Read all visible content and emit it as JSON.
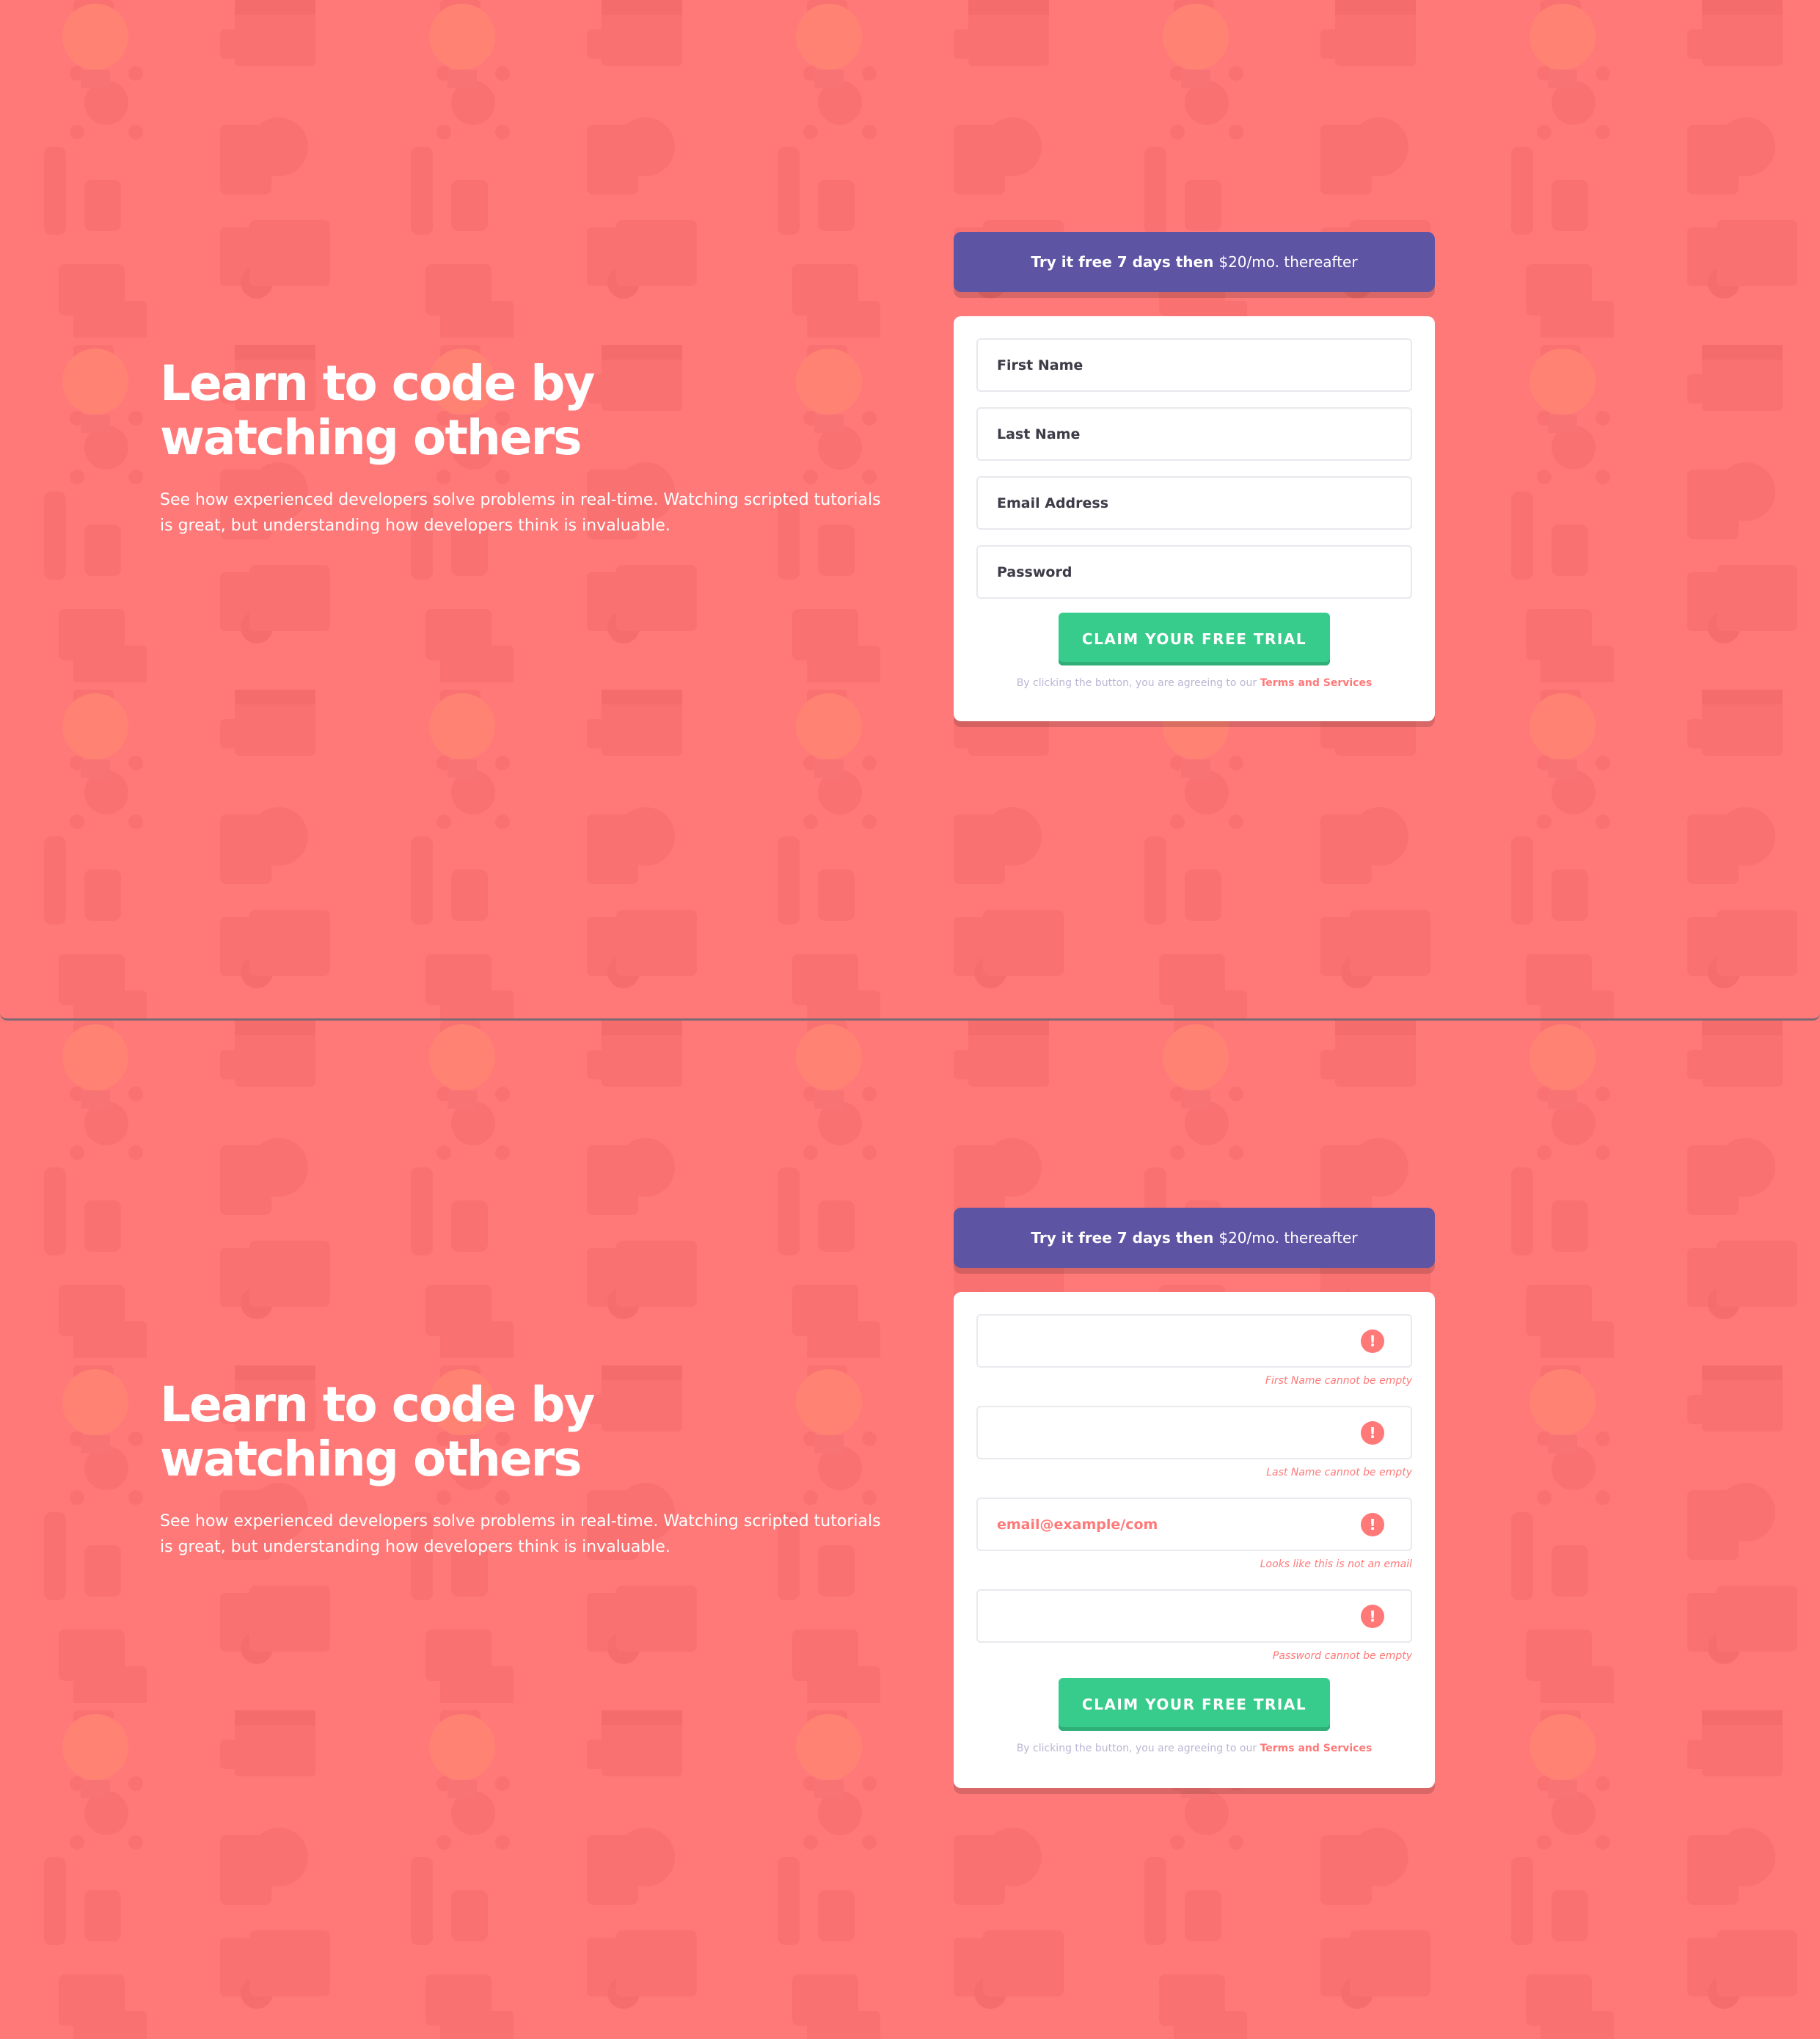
{
  "hero": {
    "title": "Learn to code by watching others",
    "description": "See how experienced developers solve problems in real-time. Watching scripted tutorials is great, but understanding how developers think is invaluable."
  },
  "banner": {
    "bold": "Try it free 7 days then",
    "rest": "$20/mo. thereafter"
  },
  "form": {
    "placeholders": {
      "first_name": "First Name",
      "last_name": "Last Name",
      "email": "Email Address",
      "password": "Password"
    },
    "submit_label": "Claim your free trial",
    "terms_text": "By clicking the button, you are agreeing to our",
    "terms_link": "Terms and Services"
  },
  "error_state": {
    "email_value": "email@example/com",
    "error_icon": "!",
    "messages": {
      "first_name": "First Name cannot be empty",
      "last_name": "Last Name cannot be empty",
      "email": "Looks like this is not an email",
      "password": "Password cannot be empty"
    }
  },
  "colors": {
    "background": "#ff7979",
    "banner": "#5e54a4",
    "cta": "#38cc8c",
    "error": "#ff7979",
    "text_dark": "#3d3b48",
    "muted": "#b9b6d3"
  }
}
